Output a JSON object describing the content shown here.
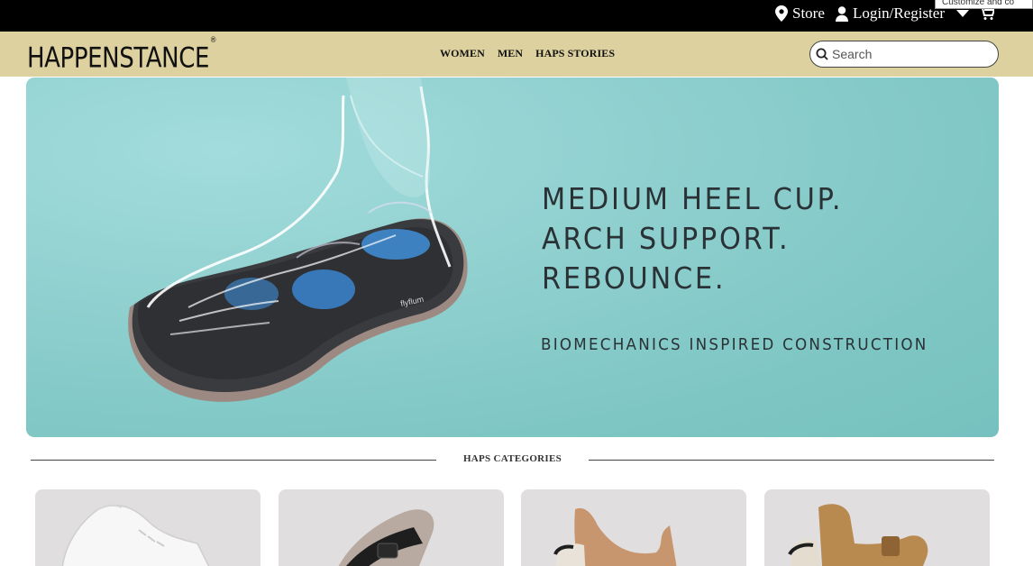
{
  "topbar": {
    "store_label": "Store",
    "login_label": "Login/Register",
    "tooltip_text": "Customize and co"
  },
  "header": {
    "logo_text": "HAPPENSTANCE",
    "logo_mark": "®",
    "nav": [
      "WOMEN",
      "MEN",
      "HAPS STORIES"
    ],
    "search_placeholder": "Search"
  },
  "hero": {
    "lines": [
      "MEDIUM HEEL CUP.",
      "ARCH SUPPORT.",
      "REBOUNCE."
    ],
    "subline": "BIOMECHANICS INSPIRED CONSTRUCTION",
    "insole_brand": "flyflum"
  },
  "categories": {
    "title": "HAPS CATEGORIES",
    "items": [
      {
        "icon": "white-sneaker-image"
      },
      {
        "icon": "black-strap-sandal-image"
      },
      {
        "icon": "tan-heel-sandal-image"
      },
      {
        "icon": "brown-buckle-sandal-image"
      }
    ]
  },
  "colors": {
    "topbar": "#000000",
    "header": "#ddd1a0",
    "hero_bg": "#8fd0cf",
    "card_bg": "#e0dedf"
  }
}
